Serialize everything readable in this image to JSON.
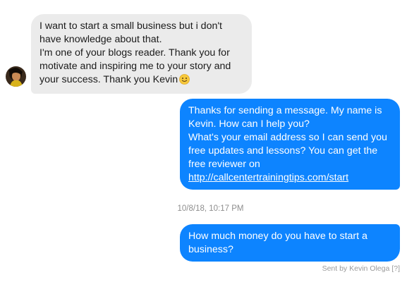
{
  "conversation": {
    "incoming_message": {
      "lines": [
        "I want to start a small business but i don't",
        "have knowledge about that.",
        "I'm one of your blogs reader. Thank you for",
        "motivate and inspiring me to your story and",
        "your success. Thank you Kevin"
      ],
      "emoji_icon": "smiley-emoji-icon"
    },
    "outgoing_message_1": {
      "lines": [
        "Thanks for sending a message. My name is",
        "Kevin. How can I help you?",
        "What's your email address so I can send you",
        "free updates and lessons? You can get the",
        "free reviewer on"
      ],
      "link": "http://callcentertrainingtips.com/start"
    },
    "timestamp": "10/8/18, 10:17 PM",
    "outgoing_message_2": {
      "lines": [
        "How much money do you have to start a",
        "business?"
      ]
    },
    "sent_by": "Sent by Kevin Olega",
    "help_marker": "[?]"
  },
  "colors": {
    "incoming_bubble": "#ebebeb",
    "outgoing_bubble": "#0d84ff",
    "meta_text": "#8e8e8e"
  }
}
